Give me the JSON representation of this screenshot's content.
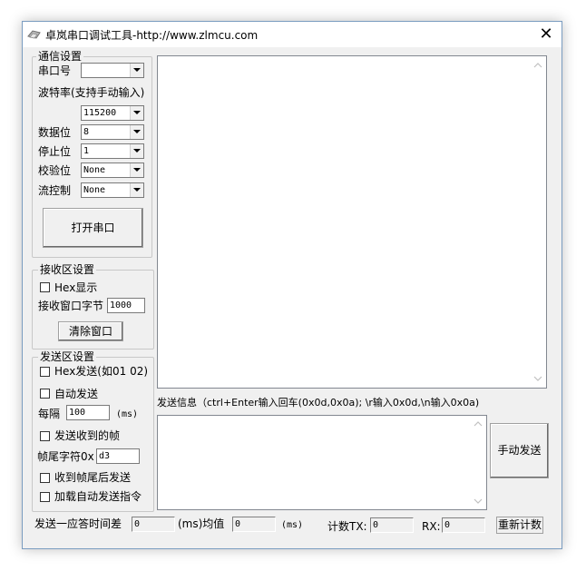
{
  "window": {
    "title": "卓岚串口调试工具-http://www.zlmcu.com",
    "close_glyph": "✕"
  },
  "comm": {
    "legend": "通信设置",
    "port_label": "串口号",
    "port_value": "",
    "baud_label": "波特率(支持手动输入)",
    "baud_value": "115200",
    "databits_label": "数据位",
    "databits_value": "8",
    "stopbits_label": "停止位",
    "stopbits_value": "1",
    "parity_label": "校验位",
    "parity_value": "None",
    "flow_label": "流控制",
    "flow_value": "None",
    "open_button": "打开串口"
  },
  "receive": {
    "legend": "接收区设置",
    "hex_display": "Hex显示",
    "window_bytes_label": "接收窗口字节",
    "window_bytes_value": "1000",
    "clear_button": "清除窗口"
  },
  "send": {
    "legend": "发送区设置",
    "hex_send": "Hex发送(如01 02)",
    "auto_send": "自动发送",
    "interval_label": "每隔",
    "interval_value": "100",
    "interval_unit": "(ms)",
    "send_on_frame": "发送收到的帧",
    "tail_label": "帧尾字符0x",
    "tail_value": "d3",
    "send_after_tail": "收到帧尾后发送",
    "load_auto_cmd": "加载自动发送指令"
  },
  "send_info": {
    "label": "发送信息（ctrl+Enter输入回车(0x0d,0x0a); \\r输入0x0d,\\n输入0x0a)",
    "manual_send_button": "手动发送"
  },
  "status": {
    "response_label": "发送一应答时间差",
    "response_value": "0",
    "ms_avg_label": "(ms)均值",
    "avg_value": "0",
    "ms_label": "(ms)",
    "tx_label": "计数TX:",
    "tx_value": "0",
    "rx_label": "RX:",
    "rx_value": "0",
    "reset_button": "重新计数"
  },
  "icons": {
    "title": "serial-tool-icon",
    "close": "close-icon",
    "dropdown": "chevron-down-icon"
  }
}
